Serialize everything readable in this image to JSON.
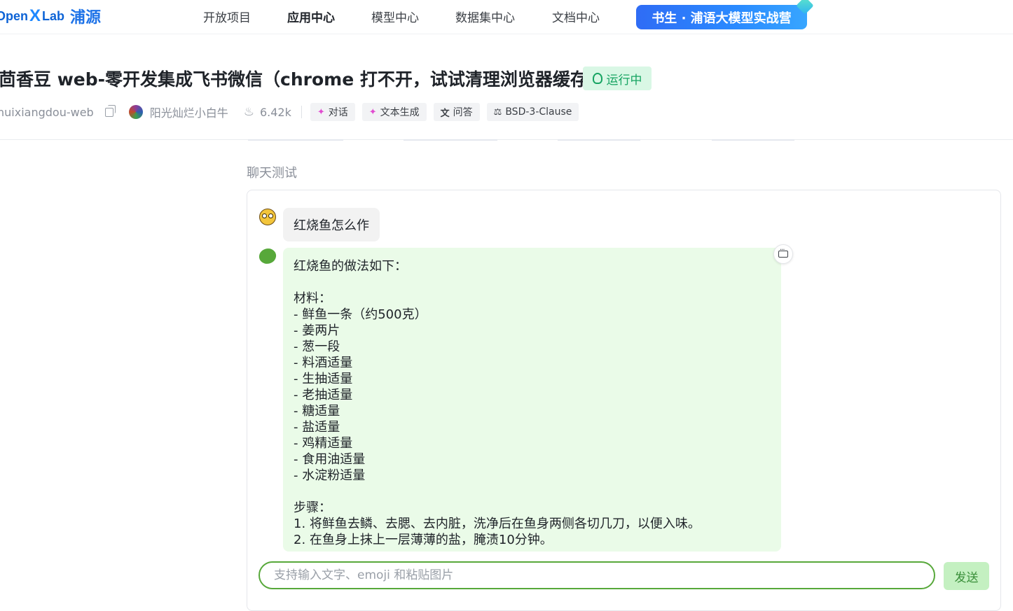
{
  "logo": {
    "open": "Open",
    "x": "X",
    "lab": "Lab",
    "cn": "浦源"
  },
  "nav": {
    "items": [
      {
        "label": "开放项目"
      },
      {
        "label": "应用中心",
        "active": true
      },
      {
        "label": "模型中心"
      },
      {
        "label": "数据集中心"
      },
      {
        "label": "文档中心"
      }
    ],
    "promo": "书生 · 浦语大模型实战营"
  },
  "project": {
    "title": "茴香豆 web-零开发集成飞书微信（chrome 打不开，试试清理浏览器缓存）",
    "status": "运行中",
    "repo": "huixiangdou-web",
    "author": "阳光灿烂小白牛",
    "views": "6.42k",
    "tags": [
      "对话",
      "文本生成",
      "问答",
      "BSD-3-Clause"
    ]
  },
  "chat": {
    "section_title": "聊天测试",
    "user_message": "红烧鱼怎么作",
    "bot_message_lines": [
      "红烧鱼的做法如下：",
      "",
      "材料：",
      "- 鲜鱼一条（约500克）",
      "- 姜两片",
      "- 葱一段",
      "- 料酒适量",
      "- 生抽适量",
      "- 老抽适量",
      "- 糖适量",
      "- 盐适量",
      "- 鸡精适量",
      "- 食用油适量",
      "- 水淀粉适量",
      "",
      "步骤：",
      "1. 将鲜鱼去鳞、去腮、去内脏，洗净后在鱼身两侧各切几刀，以便入味。",
      "2. 在鱼身上抹上一层薄薄的盐，腌渍10分钟。"
    ],
    "input_placeholder": "支持输入文字、emoji 和粘贴图片",
    "send_label": "发送"
  },
  "colors": {
    "brand_blue": "#1e73e8",
    "status_green": "#17a462",
    "bot_bubble_bg": "#eafbe8",
    "input_border": "#57a83a"
  }
}
